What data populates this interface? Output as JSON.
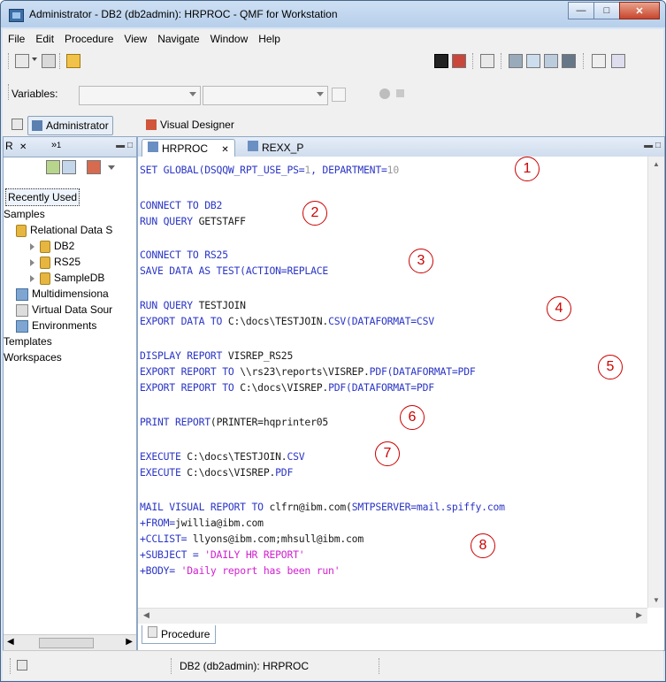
{
  "window": {
    "title": "Administrator - DB2 (db2admin): HRPROC - QMF for Workstation"
  },
  "menu": [
    "File",
    "Edit",
    "Procedure",
    "View",
    "Navigate",
    "Window",
    "Help"
  ],
  "toolbar": {
    "variables_label": "Variables:"
  },
  "perspectives": [
    {
      "label": "Administrator",
      "active": true
    },
    {
      "label": "Visual Designer",
      "active": false
    }
  ],
  "left_panel": {
    "tab_label": "R",
    "tab_count": "1",
    "tree": [
      {
        "label": "Recently Used",
        "indent": 0,
        "selected": true
      },
      {
        "label": "Samples",
        "indent": 0
      },
      {
        "label": "Relational Data S",
        "indent": 1
      },
      {
        "label": "DB2",
        "indent": 2
      },
      {
        "label": "RS25",
        "indent": 2
      },
      {
        "label": "SampleDB",
        "indent": 2
      },
      {
        "label": "Multidimensiona",
        "indent": 1
      },
      {
        "label": "Virtual Data Sour",
        "indent": 1
      },
      {
        "label": "Environments",
        "indent": 1
      },
      {
        "label": "Templates",
        "indent": 0
      },
      {
        "label": "Workspaces",
        "indent": 0
      }
    ]
  },
  "editor": {
    "tabs": [
      {
        "label": "HRPROC",
        "active": true
      },
      {
        "label": "REXX_P",
        "active": false
      }
    ],
    "bottom_tab": "Procedure",
    "lines": [
      {
        "k": "SET GLOBAL",
        "t": "(DSQQW_RPT_USE_PS=",
        "n": "1",
        "t2": ", DEPARTMENT=",
        "n2": "10"
      },
      {
        "k": "CONNECT TO DB2",
        "t": ""
      },
      {
        "k": "RUN QUERY",
        "t": " GETSTAFF"
      },
      {
        "k": "CONNECT TO RS25",
        "t": ""
      },
      {
        "k": "SAVE DATA AS TEST(ACTION=REPLACE",
        "t": ""
      },
      {
        "k": "RUN QUERY",
        "t": " TESTJOIN"
      },
      {
        "k": "EXPORT DATA TO",
        "t": " C:\\docs\\TESTJOIN.",
        "k2": "CSV(DATAFORMAT=CSV"
      },
      {
        "k": "DISPLAY REPORT",
        "t": " VISREP_RS25"
      },
      {
        "k": "EXPORT REPORT TO",
        "t": " \\\\rs23\\reports\\VISREP.",
        "k2": "PDF(DATAFORMAT=PDF"
      },
      {
        "k": "EXPORT REPORT TO",
        "t": " C:\\docs\\VISREP.",
        "k2": "PDF(DATAFORMAT=PDF"
      },
      {
        "k": "PRINT REPORT",
        "t": "(PRINTER=hqprinter05"
      },
      {
        "k": "EXECUTE",
        "t": " C:\\docs\\TESTJOIN.",
        "k2": "CSV"
      },
      {
        "k": "EXECUTE",
        "t": " C:\\docs\\VISREP.",
        "k2": "PDF"
      },
      {
        "k": "MAIL VISUAL REPORT TO",
        "t": " clfrn@ibm.com(",
        "k2": "SMTPSERVER=mail.spiffy.com"
      },
      {
        "k": "+FROM=",
        "t": "jwillia@ibm.com"
      },
      {
        "k": "+CCLIST=",
        "t": " llyons@ibm.com;mhsull@ibm.com"
      },
      {
        "k": "+SUBJECT =",
        "s": " 'DAILY HR REPORT'"
      },
      {
        "k": "+BODY=",
        "s": " 'Daily report has been run'"
      }
    ],
    "markers": [
      "1",
      "2",
      "3",
      "4",
      "5",
      "6",
      "7",
      "8"
    ]
  },
  "status": {
    "connection": "DB2 (db2admin): HRPROC"
  }
}
